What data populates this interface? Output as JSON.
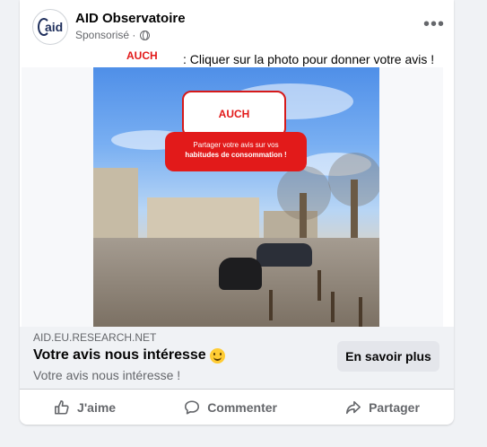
{
  "post": {
    "page_name": "AID Observatoire",
    "avatar_text": "aid",
    "sponsored_label": "Sponsorisé ·",
    "more_label": "•••",
    "brand_tag": "AUCH",
    "caption": ": Cliquer sur la photo pour donner votre avis !"
  },
  "image": {
    "badge_brand": "AUCH",
    "badge_line1": "Partager votre avis sur vos",
    "badge_line2": "habitudes de consommation !"
  },
  "link_preview": {
    "domain": "AID.EU.RESEARCH.NET",
    "headline": "Votre avis nous intéresse",
    "description": "Votre avis nous intéresse !",
    "cta_label": "En savoir plus"
  },
  "actions": {
    "like": "J'aime",
    "comment": "Commenter",
    "share": "Partager"
  },
  "icons": {
    "like": "thumbs-up-icon",
    "comment": "comment-icon",
    "share": "share-arrow-icon",
    "privacy": "globe-icon",
    "emoji": "smile-emoji-icon"
  },
  "colors": {
    "brand_red": "#e21a1a",
    "secondary_text": "#65676b",
    "button_bg": "#e4e6eb",
    "preview_bg": "#f0f2f5"
  }
}
